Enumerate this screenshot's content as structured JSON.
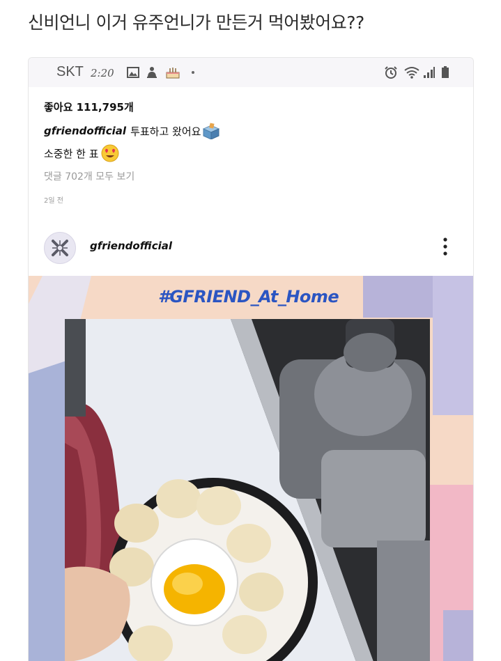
{
  "post": {
    "title": "신비언니 이거 유주언니가 만든거 먹어봤어요??"
  },
  "status_bar": {
    "carrier": "SKT",
    "time": "2:20",
    "left_icons": [
      "image-icon",
      "bell-icon",
      "cake-icon"
    ],
    "right_icons": [
      "alarm-icon",
      "wifi-icon",
      "signal-icon",
      "battery-icon"
    ]
  },
  "instagram": {
    "likes": "좋아요 111,795개",
    "caption_user": "gfriendofficial",
    "caption_text": "투표하고 왔어요",
    "caption_line2": "소중한 한 표",
    "comments_link": "댓글 702개 모두 보기",
    "date": "2일 전",
    "post_user": "gfriendofficial",
    "image_hashtag": "#GFRIEND_At_Home"
  },
  "colors": {
    "hashtag_blue": "#2b55c2",
    "banner_peach": "#f6d9c6",
    "banner_lavender": "#b7b3d9",
    "banner_pink": "#f2b8c6",
    "status_bar_bg": "#f7f6f9"
  }
}
